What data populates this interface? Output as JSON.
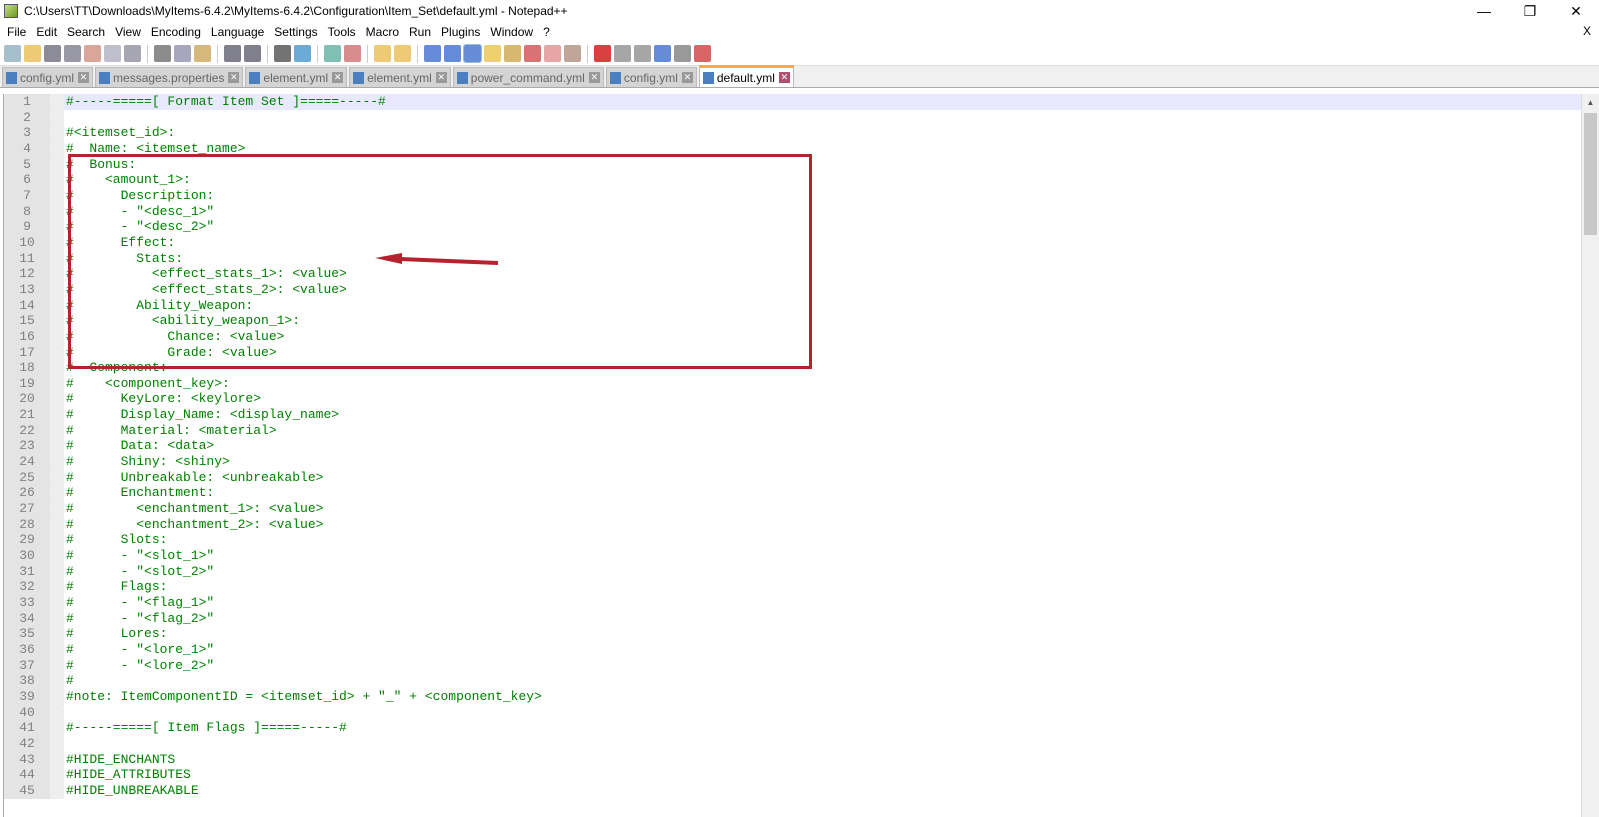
{
  "window": {
    "title": "C:\\Users\\TT\\Downloads\\MyItems-6.4.2\\MyItems-6.4.2\\Configuration\\Item_Set\\default.yml - Notepad++",
    "minimize": "—",
    "restore": "❐",
    "close": "✕"
  },
  "menu": [
    "File",
    "Edit",
    "Search",
    "View",
    "Encoding",
    "Language",
    "Settings",
    "Tools",
    "Macro",
    "Run",
    "Plugins",
    "Window",
    "?"
  ],
  "menu_close": "X",
  "tabs": [
    {
      "label": "config.yml",
      "active": false
    },
    {
      "label": "messages.properties",
      "active": false
    },
    {
      "label": "element.yml",
      "active": false
    },
    {
      "label": "element.yml",
      "active": false
    },
    {
      "label": "power_command.yml",
      "active": false
    },
    {
      "label": "config.yml",
      "active": false
    },
    {
      "label": "default.yml",
      "active": true
    }
  ],
  "colors": {
    "comment": "#008000",
    "annotation": "#b5232f",
    "current_line": "#e8e8ff"
  },
  "lines": [
    "#-----=====[ Format Item Set ]=====-----#",
    "",
    "#<itemset_id>:",
    "#  Name: <itemset_name>",
    "#  Bonus:",
    "#    <amount_1>:",
    "#      Description:",
    "#      - \"<desc_1>\"",
    "#      - \"<desc_2>\"",
    "#      Effect:",
    "#        Stats:",
    "#          <effect_stats_1>: <value>",
    "#          <effect_stats_2>: <value>",
    "#        Ability_Weapon:",
    "#          <ability_weapon_1>:",
    "#            Chance: <value>",
    "#            Grade: <value>",
    "#  Component:",
    "#    <component_key>:",
    "#      KeyLore: <keylore>",
    "#      Display_Name: <display_name>",
    "#      Material: <material>",
    "#      Data: <data>",
    "#      Shiny: <shiny>",
    "#      Unbreakable: <unbreakable>",
    "#      Enchantment:",
    "#        <enchantment_1>: <value>",
    "#        <enchantment_2>: <value>",
    "#      Slots:",
    "#      - \"<slot_1>\"",
    "#      - \"<slot_2>\"",
    "#      Flags:",
    "#      - \"<flag_1>\"",
    "#      - \"<flag_2>\"",
    "#      Lores:",
    "#      - \"<lore_1>\"",
    "#      - \"<lore_2>\"",
    "#",
    "#note: ItemComponentID = <itemset_id> + \"_\" + <component_key>",
    "",
    "#-----=====[ Item Flags ]=====-----#",
    "",
    "#HIDE_ENCHANTS",
    "#HIDE_ATTRIBUTES",
    "#HIDE_UNBREAKABLE"
  ],
  "toolbar": [
    "new",
    "open",
    "save",
    "save-all",
    "close",
    "close-all",
    "print",
    "cut",
    "copy",
    "paste",
    "undo",
    "redo",
    "find",
    "replace",
    "zoom-in",
    "zoom-out",
    "sync-v",
    "sync-h",
    "word-wrap",
    "show-all-chars",
    "indent-guide",
    "udl",
    "doc-map",
    "function-list",
    "folder-workspace",
    "monitor",
    "record-macro",
    "stop-record",
    "play-macro",
    "run-macro-multiple",
    "save-macro",
    "spell-check"
  ]
}
